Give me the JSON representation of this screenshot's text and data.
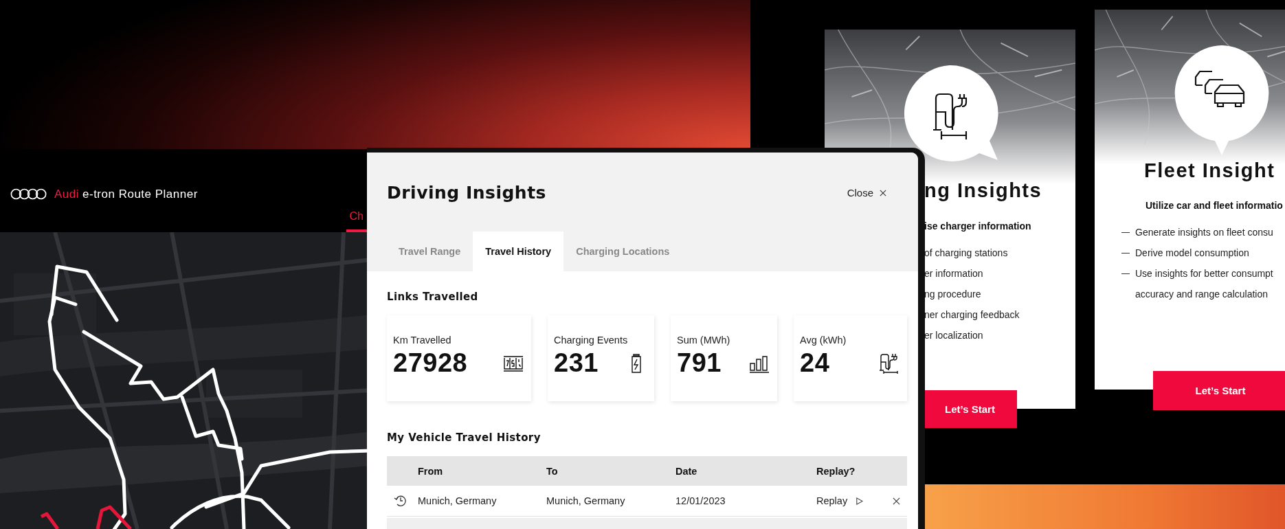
{
  "route_planner": {
    "brand": "Audi",
    "title": "e-tron Route Planner",
    "tabs": [
      {
        "label": "Ch",
        "selected": true
      }
    ]
  },
  "modal": {
    "title": "Driving Insights",
    "close": "Close",
    "tabs": [
      {
        "label": "Travel Range",
        "selected": false
      },
      {
        "label": "Travel History",
        "selected": true
      },
      {
        "label": "Charging Locations",
        "selected": false
      }
    ],
    "links_title": "Links Travelled",
    "stats": [
      {
        "kind": "odometer",
        "label": "Km Travelled",
        "value": "27928"
      },
      {
        "kind": "battery",
        "label": "Charging Events",
        "value": "231"
      },
      {
        "kind": "bars",
        "label": "Sum (MWh)",
        "value": "791"
      },
      {
        "kind": "charger",
        "label": "Avg (kWh)",
        "value": "24"
      }
    ],
    "history_title": "My Vehicle Travel History",
    "table": {
      "columns": [
        "From",
        "To",
        "Date",
        "Replay?"
      ],
      "rows": [
        {
          "from": "Munich, Germany",
          "to": "Munich, Germany",
          "date": "12/01/2023",
          "action": "Replay"
        }
      ]
    }
  },
  "cards": [
    {
      "kind": "charging",
      "title": "ng Insights",
      "subtitle": "ise charger information",
      "items": [
        {
          "lines": [
            "of charging stations"
          ]
        },
        {
          "lines": [
            "er information"
          ]
        },
        {
          "lines": [
            "ng procedure"
          ]
        },
        {
          "lines": [
            "ner charging feedback"
          ]
        },
        {
          "lines": [
            "er localization"
          ]
        }
      ],
      "button": "Let’s Start"
    },
    {
      "kind": "fleet",
      "title": "Fleet Insight",
      "subtitle": "Utilize car and fleet informatio",
      "items": [
        {
          "lines": [
            "Generate insights on fleet consu"
          ]
        },
        {
          "lines": [
            "Derive model consumption"
          ]
        },
        {
          "lines": [
            "Use insights for better consumpt",
            "accuracy and range calculation"
          ]
        }
      ],
      "button": "Let’s Start"
    }
  ]
}
